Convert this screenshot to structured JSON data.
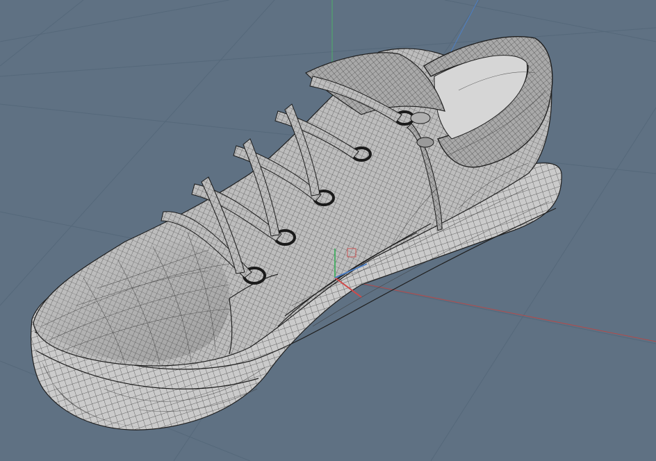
{
  "viewport": {
    "background": "#5f7183",
    "grid_color": "#55687a",
    "axis_colors": {
      "x": "#b24a4a",
      "y": "#4cae68",
      "z": "#4d7fc4"
    },
    "mode": "wireframe-on-shaded",
    "object": {
      "name": "shoe-mesh",
      "surface": "#c9c9c9",
      "wire": "#3a3a3a"
    },
    "gizmo": {
      "x_axis": "#d04a4a",
      "y_axis": "#4cae68",
      "z_axis": "#4d7fc4"
    }
  }
}
